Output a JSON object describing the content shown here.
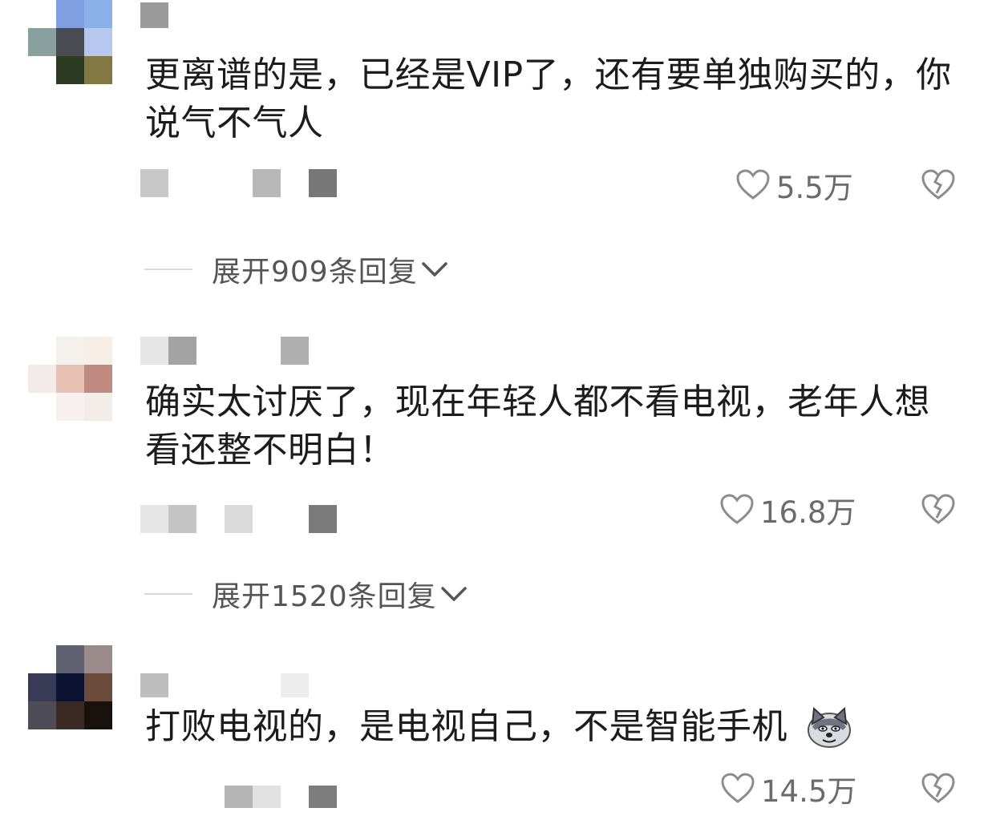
{
  "comments": [
    {
      "text": "更离谱的是，已经是VIP了，还有要单独购买的，你说气不气人",
      "likes": "5.5万",
      "replies_label": "展开909条回复",
      "avatar_colors": [
        "#7f9fe0",
        "#6a8fdd",
        "#8ab0e8",
        "#5d6b7a",
        "#4a4a52",
        "#b7c8ef",
        "#7a8c86",
        "#2c3a22",
        "#827844",
        "#6c7b8c",
        "#334a2a",
        "#97904f"
      ]
    },
    {
      "text": "确实太讨厌了，现在年轻人都不看电视，老年人想看还整不明白！",
      "likes": "16.8万",
      "replies_label": "展开1520条回复",
      "avatar_colors": [
        "#f4f1ec",
        "#f7efe6",
        "#f2ebe4",
        "#f3ebe9",
        "#e7c1b3",
        "#c08a80",
        "#f6f0ee",
        "#f7f3f2",
        "#f2ede9"
      ]
    },
    {
      "text": "打败电视的，是电视自己，不是智能手机",
      "likes": "14.5万",
      "avatar_colors": [
        "#5f6170",
        "#9a8b8a",
        "#393a55",
        "#0c1232",
        "#6a4b3c",
        "#4e4d57",
        "#3b2a24",
        "#17120d"
      ]
    }
  ]
}
